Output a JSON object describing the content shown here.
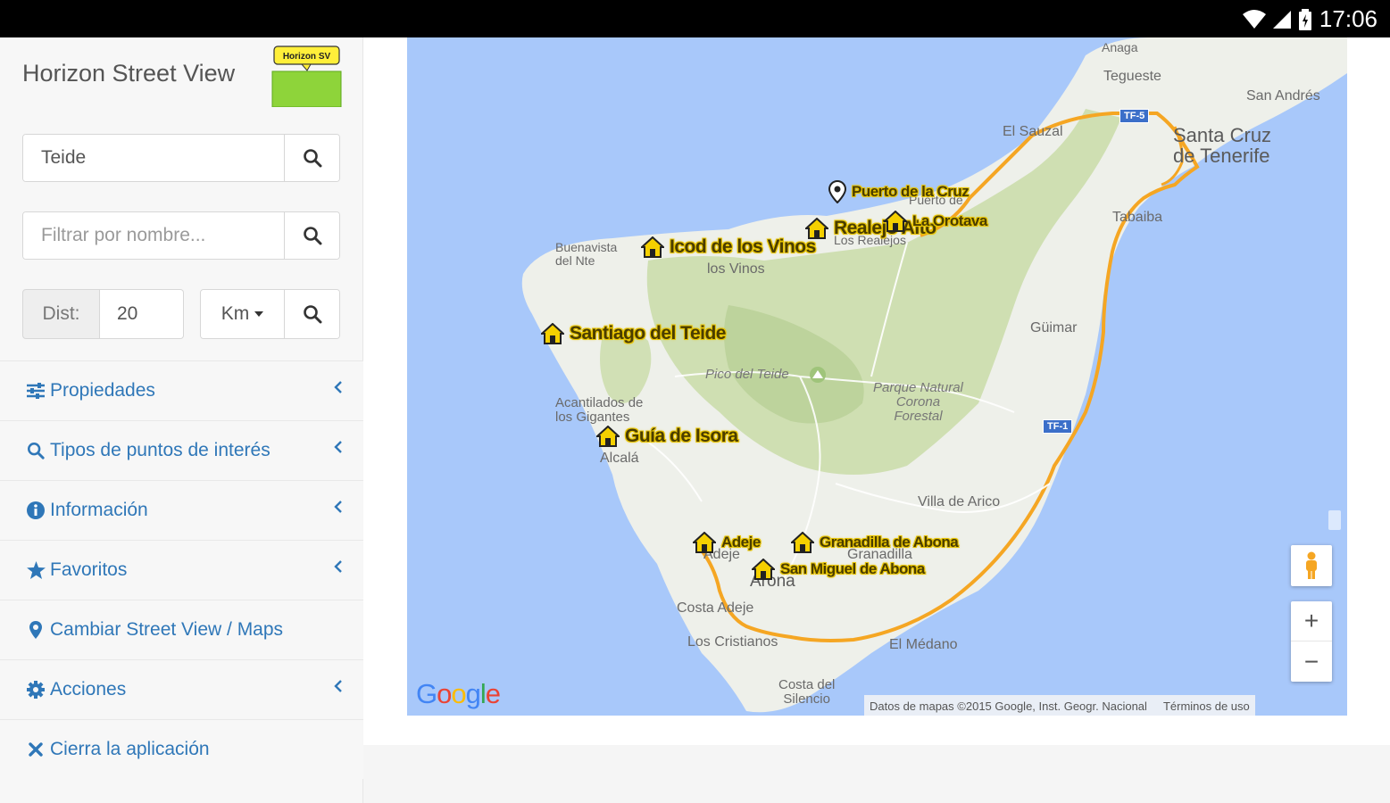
{
  "status_bar": {
    "time": "17:06"
  },
  "app": {
    "title": "Horizon Street View",
    "logo_text": "Horizon SV"
  },
  "search": {
    "value": "Teide",
    "placeholder": ""
  },
  "filter": {
    "value": "",
    "placeholder": "Filtrar por nombre..."
  },
  "distance": {
    "label": "Dist:",
    "value": "20",
    "unit": "Km"
  },
  "menu": {
    "items": [
      {
        "label": "Propiedades",
        "icon": "sliders-icon",
        "has_chevron": true
      },
      {
        "label": "Tipos de puntos de interés",
        "icon": "search-icon",
        "has_chevron": true
      },
      {
        "label": "Información",
        "icon": "info-icon",
        "has_chevron": true
      },
      {
        "label": "Favoritos",
        "icon": "star-icon",
        "has_chevron": true
      },
      {
        "label": "Cambiar Street View / Maps",
        "icon": "map-marker-icon",
        "has_chevron": false
      },
      {
        "label": "Acciones",
        "icon": "gear-icon",
        "has_chevron": true
      },
      {
        "label": "Cierra la aplicación",
        "icon": "close-icon",
        "has_chevron": false
      }
    ]
  },
  "map": {
    "places": {
      "anaga": "Anaga",
      "tegueste": "Tegueste",
      "san_andres": "San Andrés",
      "santa_cruz": "Santa Cruz\nde Tenerife",
      "el_sauzal": "El Sauzal",
      "buenavista": "Buenavista\ndel Nte",
      "los_vinos": "los Vinos",
      "los_realejos": "Los Realejos",
      "tabaiba": "Tabaiba",
      "guimar": "Güimar",
      "pico_teide": "Pico del Teide",
      "parque": "Parque Natural\nCorona\nForestal",
      "acantilados": "Acantilados de\nlos Gigantes",
      "alcala": "Alcalá",
      "villa_arico": "Villa de Arico",
      "adeje_place": "Adeje",
      "granadilla_place": "Granadilla",
      "arona": "Arona",
      "costa_adeje": "Costa Adeje",
      "los_cristianos": "Los Cristianos",
      "el_medano": "El Médano",
      "costa_silencio": "Costa del\nSilencio",
      "puerto_cruz_partial": "Puerto de"
    },
    "road_shields": {
      "tf5": "TF-5",
      "tf1": "TF-1"
    },
    "pois": [
      {
        "label": "Puerto de la Cruz",
        "icon": "map-pin-icon"
      },
      {
        "label": "Realejo Alto",
        "icon": "house-icon"
      },
      {
        "label": "La Orotava",
        "icon": "house-icon"
      },
      {
        "label": "Icod de los Vinos",
        "icon": "house-icon"
      },
      {
        "label": "Santiago del Teide",
        "icon": "house-icon"
      },
      {
        "label": "Guía de Isora",
        "icon": "house-icon"
      },
      {
        "label": "Adeje",
        "icon": "house-icon"
      },
      {
        "label": "Granadilla de Abona",
        "icon": "house-icon"
      },
      {
        "label": "San Miguel de Abona",
        "icon": "house-icon"
      }
    ],
    "google_logo": "Google",
    "attribution": "Datos de mapas ©2015 Google, Inst. Geogr. Nacional",
    "terms": "Términos de uso",
    "zoom_in": "+",
    "zoom_out": "−"
  },
  "colors": {
    "accent": "#2f77b8",
    "sea": "#a8c8fa",
    "land": "#eef0ea",
    "park": "#c9dca8",
    "road": "#f5a623",
    "poi_label": "#e8c400"
  }
}
